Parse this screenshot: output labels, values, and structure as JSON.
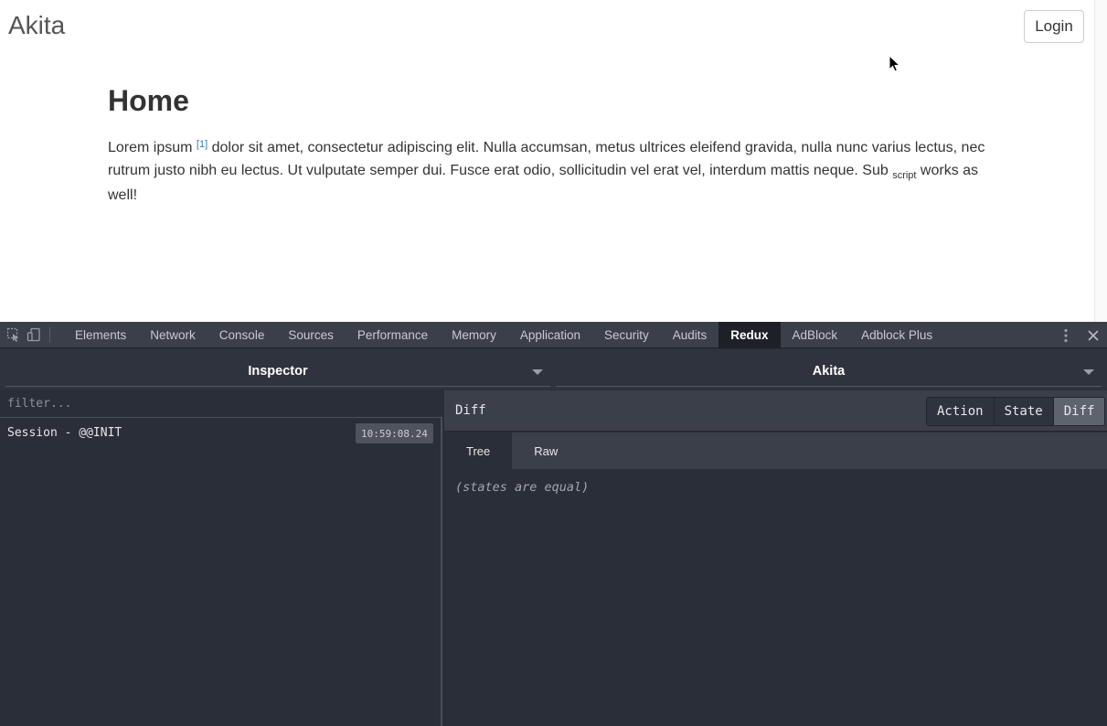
{
  "page": {
    "brand": "Akita",
    "login_label": "Login",
    "title": "Home",
    "paragraph": {
      "text1": "Lorem ipsum ",
      "sup": "[1]",
      "text2": " dolor sit amet, consectetur adipiscing elit. Nulla accumsan, metus ultrices eleifend gravida, nulla nunc varius lectus, nec rutrum justo nibh eu lectus. Ut vulputate semper dui. Fusce erat odio, sollicitudin vel erat vel, interdum mattis neque. Sub ",
      "sub": "script",
      "text3": " works as well!"
    }
  },
  "devtools": {
    "tabs": [
      "Elements",
      "Network",
      "Console",
      "Sources",
      "Performance",
      "Memory",
      "Application",
      "Security",
      "Audits",
      "Redux",
      "AdBlock",
      "Adblock Plus"
    ],
    "active_tab": "Redux",
    "monitor_select": "Inspector",
    "instance_select": "Akita",
    "filter_placeholder": "filter...",
    "actions": [
      {
        "name": "Session - @@INIT",
        "time": "10:59:08.24"
      }
    ],
    "right": {
      "title": "Diff",
      "segments": [
        "Action",
        "State",
        "Diff"
      ],
      "active_segment": "Diff",
      "subtabs": [
        "Tree",
        "Raw"
      ],
      "active_subtab": "Tree",
      "body_text": "(states are equal)"
    }
  },
  "colors": {
    "devtools_bg": "#2a2e38",
    "devtools_bar": "#3b3f4a",
    "active_tab_bg": "#1e2027",
    "link": "#337ab7"
  }
}
